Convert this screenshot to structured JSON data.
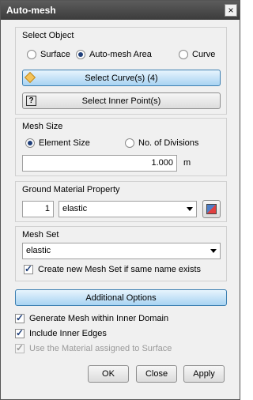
{
  "window": {
    "title": "Auto-mesh",
    "close_glyph": "×"
  },
  "select_object": {
    "title": "Select Object",
    "radios": [
      {
        "label": "Surface",
        "checked": false
      },
      {
        "label": "Auto-mesh Area",
        "checked": true
      },
      {
        "label": "Curve",
        "checked": false
      }
    ],
    "select_curves_label": "Select Curve(s) (4)",
    "select_inner_points_label": "Select Inner Point(s)",
    "inner_point_icon": "?"
  },
  "mesh_size": {
    "title": "Mesh Size",
    "radios": [
      {
        "label": "Element Size",
        "checked": true
      },
      {
        "label": "No. of Divisions",
        "checked": false
      }
    ],
    "value": "1.000",
    "unit": "m"
  },
  "ground_material": {
    "title": "Ground Material Property",
    "id": "1",
    "selected": "elastic"
  },
  "mesh_set": {
    "title": "Mesh Set",
    "selected": "elastic",
    "create_new_label": "Create new Mesh Set if same name exists",
    "create_new_checked": true
  },
  "additional_options_label": "Additional Options",
  "options": [
    {
      "label": "Generate Mesh within Inner Domain",
      "checked": true,
      "enabled": true
    },
    {
      "label": "Include Inner Edges",
      "checked": true,
      "enabled": true
    },
    {
      "label": "Use the Material assigned to Surface",
      "checked": true,
      "enabled": false
    }
  ],
  "footer": {
    "ok": "OK",
    "close": "Close",
    "apply": "Apply"
  },
  "colors": {
    "accent_button": "#a8d3f2",
    "titlebar": "#4a4a4a"
  }
}
